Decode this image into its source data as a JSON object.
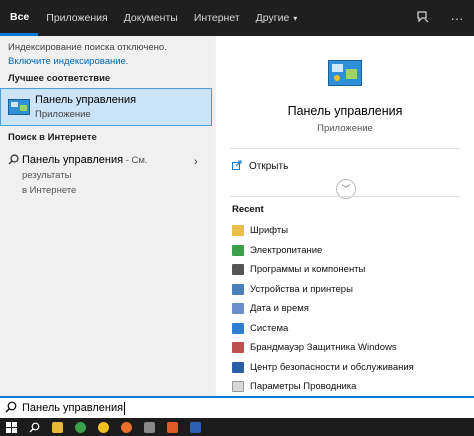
{
  "topbar": {
    "tabs": [
      {
        "label": "Все",
        "active": true
      },
      {
        "label": "Приложения"
      },
      {
        "label": "Документы"
      },
      {
        "label": "Интернет"
      },
      {
        "label": "Другие"
      }
    ],
    "more_chevron": "▾",
    "feedback_icon": "feedback-icon",
    "more_icon_glyph": "···"
  },
  "left": {
    "notice_text": "Индексирование поиска отключено.",
    "notice_link": "Включите индексирование.",
    "best_match_header": "Лучшее соответствие",
    "best_match": {
      "title": "Панель управления",
      "subtitle": "Приложение"
    },
    "web_header": "Поиск в Интернете",
    "web_result": {
      "title": "Панель управления",
      "suffix": " - См. результаты",
      "suffix2": "в Интернете"
    }
  },
  "right": {
    "app_title": "Панель управления",
    "app_subtitle": "Приложение",
    "open_label": "Открыть",
    "recent_header": "Recent",
    "recent_items": [
      {
        "label": "Шрифты",
        "color": "#e8c04a"
      },
      {
        "label": "Электропитание",
        "color": "#3aa04a"
      },
      {
        "label": "Программы и компоненты",
        "color": "#555555"
      },
      {
        "label": "Устройства и принтеры",
        "color": "#4a7fb8"
      },
      {
        "label": "Дата и время",
        "color": "#6a8fc8"
      },
      {
        "label": "Система",
        "color": "#2f7fd1"
      },
      {
        "label": "Брандмауэр Защитника Windows",
        "color": "#c0504d"
      },
      {
        "label": "Центр безопасности и обслуживания",
        "color": "#2a5fa8"
      },
      {
        "label": "Параметры Проводника",
        "color": "#d8d8d8"
      }
    ]
  },
  "search": {
    "query": "Панель управления"
  },
  "taskbar": {
    "apps": [
      {
        "name": "folder",
        "color": "#e8b83a"
      },
      {
        "name": "utorrent",
        "color": "#3aa04a"
      },
      {
        "name": "norton",
        "color": "#f0c020"
      },
      {
        "name": "firefox",
        "color": "#e8702a"
      },
      {
        "name": "calc",
        "color": "#888888"
      },
      {
        "name": "brave",
        "color": "#e05a2a"
      },
      {
        "name": "word",
        "color": "#2b5fb4"
      }
    ]
  }
}
